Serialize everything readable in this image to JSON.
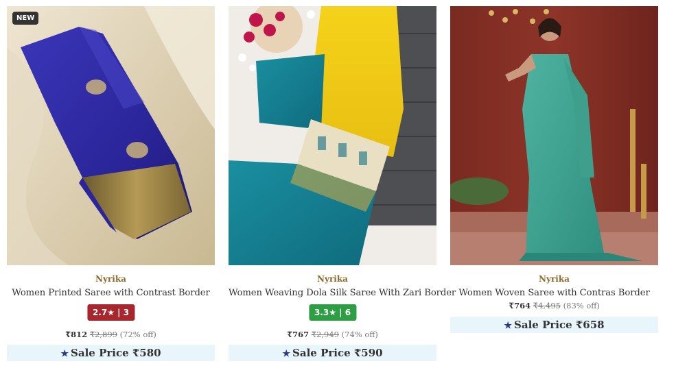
{
  "products": [
    {
      "badge": "NEW",
      "brand": "Nyrika",
      "title": "Women Printed Saree with Contrast Border",
      "rating": "2.7★ | 3",
      "rating_color": "#a8272e",
      "price": "₹812",
      "mrp": "₹2,899",
      "discount": "(72% off)",
      "sale_label": "Sale Price ₹580",
      "image_icon": "saree-image"
    },
    {
      "brand": "Nyrika",
      "title": "Women Weaving Dola Silk Saree With Zari Border",
      "rating": "3.3★ | 6",
      "rating_color": "#2e9e44",
      "price": "₹767",
      "mrp": "₹2,949",
      "discount": "(74% off)",
      "sale_label": "Sale Price ₹590",
      "image_icon": "saree-image"
    },
    {
      "brand": "Nyrika",
      "title": "Women Woven Saree with Contras Border",
      "price": "₹764",
      "mrp": "₹4,495",
      "discount": "(83% off)",
      "sale_label": "Sale Price ₹658",
      "image_icon": "saree-image"
    }
  ],
  "sale_star_icon": "star-icon"
}
